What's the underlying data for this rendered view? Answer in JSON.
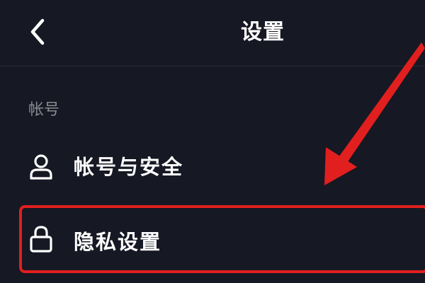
{
  "header": {
    "title": "设置",
    "back_icon": "chevron-left-icon"
  },
  "sections": [
    {
      "label": "帐号",
      "items": [
        {
          "label": "帐号与安全",
          "icon": "user-icon"
        },
        {
          "label": "隐私设置",
          "icon": "lock-icon"
        }
      ]
    }
  ],
  "annotation": {
    "highlight_color": "#e21f1f",
    "highlighted_item": "隐私设置"
  },
  "colors": {
    "background": "#161823",
    "text_primary": "#ffffff",
    "text_secondary": "#8a8b91"
  }
}
